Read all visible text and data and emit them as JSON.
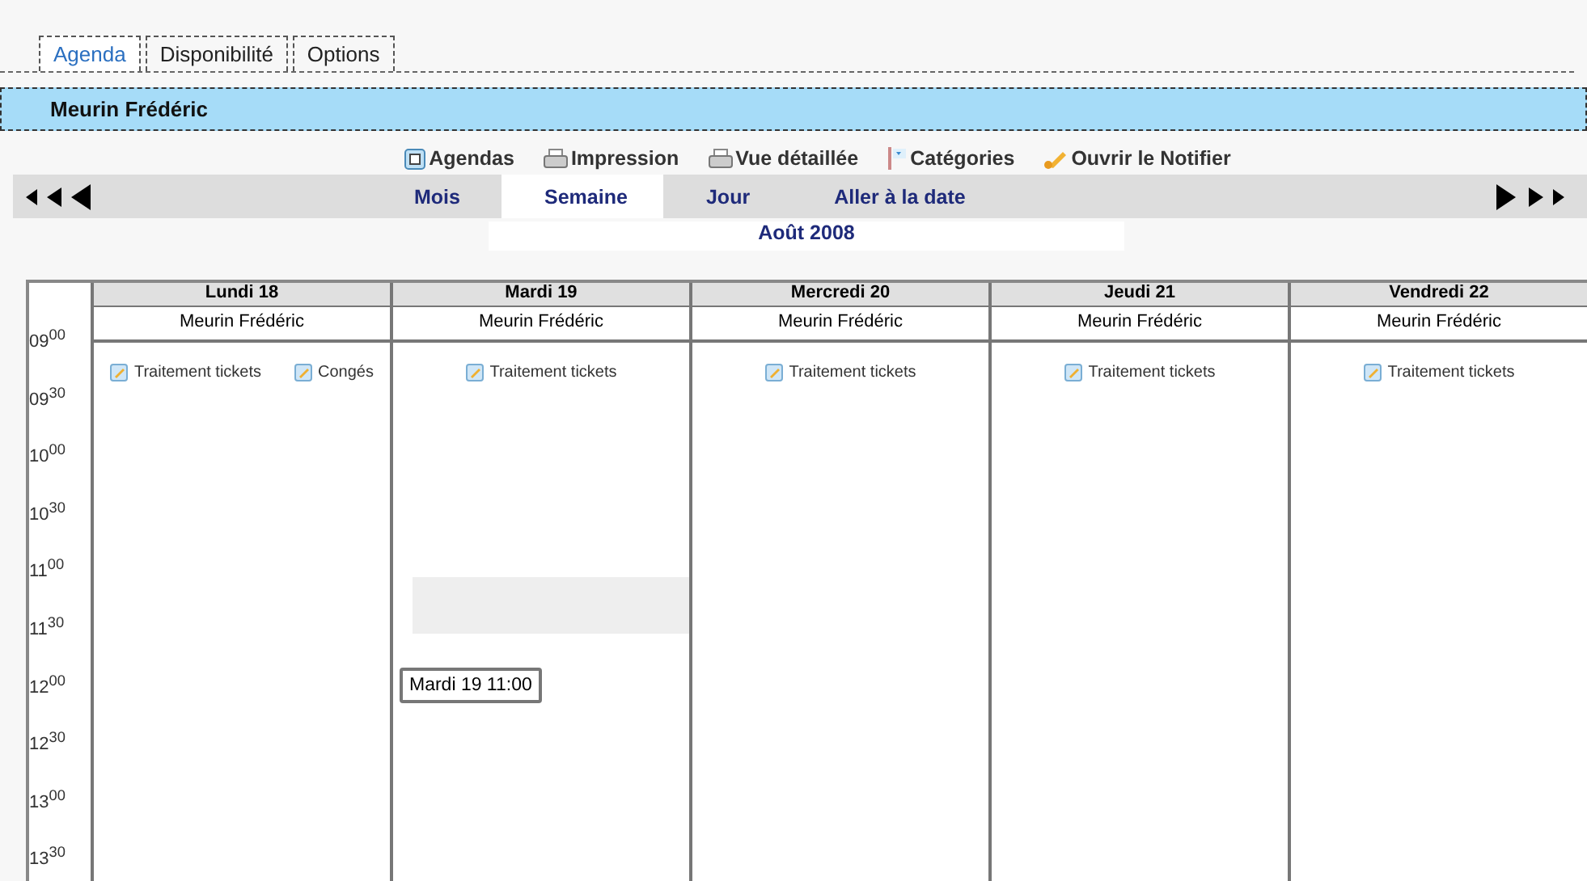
{
  "tabs": [
    {
      "label": "Agenda",
      "selected": true
    },
    {
      "label": "Disponibilité",
      "selected": false
    },
    {
      "label": "Options",
      "selected": false
    }
  ],
  "user_bar": {
    "name": "Meurin Frédéric"
  },
  "toolbar": [
    {
      "kind": "agendas",
      "label": "Agendas"
    },
    {
      "kind": "print",
      "label": "Impression"
    },
    {
      "kind": "print",
      "label": "Vue détaillée"
    },
    {
      "kind": "categories",
      "label": "Catégories"
    },
    {
      "kind": "notifier",
      "label": "Ouvrir le Notifier"
    }
  ],
  "view_tabs": [
    {
      "label": "Mois",
      "selected": false
    },
    {
      "label": "Semaine",
      "selected": true
    },
    {
      "label": "Jour",
      "selected": false
    },
    {
      "label": "Aller à la date",
      "selected": false
    }
  ],
  "period": "Août 2008",
  "times": [
    "09$^{00}$",
    "09$^{30}$",
    "10$^{00}$",
    "10$^{30}$",
    "11$^{00}$",
    "11$^{30}$",
    "12$^{00}$",
    "12$^{30}$",
    "13$^{00}$",
    "13$^{30}$"
  ],
  "days": [
    {
      "title": "Lundi 18",
      "person": "Meurin Frédéric",
      "events": [
        "Traitement tickets",
        "Congés"
      ],
      "highlighted": false
    },
    {
      "title": "Mardi 19",
      "person": "Meurin Frédéric",
      "events": [
        "Traitement tickets"
      ],
      "highlighted": true,
      "tooltip": "Mardi 19 11:00"
    },
    {
      "title": "Mercredi 20",
      "person": "Meurin Frédéric",
      "events": [
        "Traitement tickets"
      ],
      "highlighted": false
    },
    {
      "title": "Jeudi 21",
      "person": "Meurin Frédéric",
      "events": [
        "Traitement tickets"
      ],
      "highlighted": false
    },
    {
      "title": "Vendredi 22",
      "person": "Meurin Frédéric",
      "events": [
        "Traitement tickets"
      ],
      "highlighted": false
    }
  ]
}
